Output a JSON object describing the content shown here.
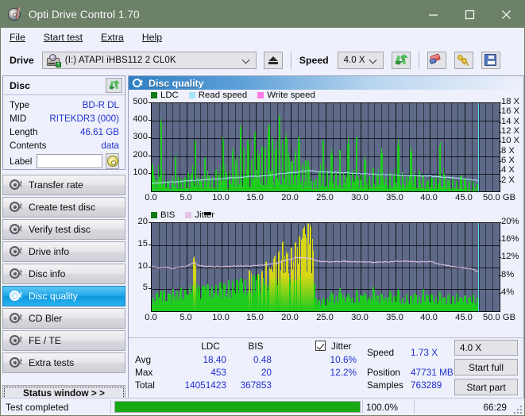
{
  "window": {
    "title": "Opti Drive Control 1.70",
    "minimize": "minimize",
    "maximize": "maximize",
    "close": "close"
  },
  "menu": [
    {
      "label": "File"
    },
    {
      "label": "Start test"
    },
    {
      "label": "Extra"
    },
    {
      "label": "Help"
    }
  ],
  "toolbar": {
    "drive_label": "Drive",
    "drive_value": "(I:)  ATAPI iHBS112  2 CL0K",
    "eject_title": "Eject",
    "speed_label": "Speed",
    "speed_value": "4.0 X",
    "refresh_title": "Refresh",
    "erase_title": "Erase",
    "keys_title": "Keys",
    "save_title": "Save"
  },
  "disc_panel": {
    "title": "Disc",
    "refresh_title": "Refresh disc info",
    "rows": [
      {
        "key": "Type",
        "value": "BD-R DL"
      },
      {
        "key": "MID",
        "value": "RITEKDR3 (000)"
      },
      {
        "key": "Length",
        "value": "46.61 GB"
      },
      {
        "key": "Contents",
        "value": "data"
      }
    ],
    "label_key": "Label",
    "label_value": "",
    "label_placeholder": ""
  },
  "sidebar": {
    "items": [
      {
        "label": "Transfer rate",
        "active": false
      },
      {
        "label": "Create test disc",
        "active": false
      },
      {
        "label": "Verify test disc",
        "active": false
      },
      {
        "label": "Drive info",
        "active": false
      },
      {
        "label": "Disc info",
        "active": false
      },
      {
        "label": "Disc quality",
        "active": true
      },
      {
        "label": "CD Bler",
        "active": false
      },
      {
        "label": "FE / TE",
        "active": false
      },
      {
        "label": "Extra tests",
        "active": false
      }
    ],
    "status_window_button": "Status window > >"
  },
  "content": {
    "header_title": "Disc quality"
  },
  "stats": {
    "col_ldc": "LDC",
    "col_bis": "BIS",
    "jitter_label": "Jitter",
    "jitter_checked": true,
    "rows": [
      {
        "name": "Avg",
        "ldc": "18.40",
        "bis": "0.48",
        "jitter": "10.6%"
      },
      {
        "name": "Max",
        "ldc": "453",
        "bis": "20",
        "jitter": "12.2%"
      },
      {
        "name": "Total",
        "ldc": "14051423",
        "bis": "367853",
        "jitter": ""
      }
    ],
    "speed_key": "Speed",
    "speed_value": "1.73 X",
    "position_key": "Position",
    "position_value": "47731 MB",
    "samples_key": "Samples",
    "samples_value": "763289",
    "speed_select_value": "4.0 X",
    "start_full": "Start full",
    "start_part": "Start part"
  },
  "statusbar": {
    "message": "Test completed",
    "progress_percent": "100.0%",
    "progress_value": 100,
    "elapsed": "66:29"
  },
  "colors": {
    "title_bar": "#6d8068",
    "accent": "#2031d0",
    "plot_bg": "#5e6a88",
    "ldc_green": "#1ecb1e",
    "bis_green": "#1ecb1e",
    "jitter_pink": "#e6c4e6",
    "read_speed": "#a8e4f7",
    "write_speed": "#ff7ae0",
    "cursor": "#63d8f5",
    "progress": "#14a814",
    "active_nav": "#22a6e8"
  },
  "chart_data": [
    {
      "type": "bar",
      "id": "ldc-chart",
      "title": "",
      "legend": [
        {
          "label": "LDC",
          "color": "#0f7a14"
        },
        {
          "label": "Read speed",
          "color": "#a8e4f7"
        },
        {
          "label": "Write speed",
          "color": "#ff7ae0"
        }
      ],
      "legend_position": "top-left",
      "xlabel": "GB",
      "ylabel": "",
      "y2label": "X",
      "xlim": [
        0.0,
        50.0
      ],
      "ylim": [
        0,
        500
      ],
      "y2lim": [
        0,
        18
      ],
      "xticks": [
        0.0,
        5.0,
        10.0,
        15.0,
        20.0,
        25.0,
        30.0,
        35.0,
        40.0,
        45.0,
        50.0
      ],
      "xticklabels": [
        "0.0",
        "5.0",
        "10.0",
        "15.0",
        "20.0",
        "25.0",
        "30.0",
        "35.0",
        "40.0",
        "45.0",
        "50.0 GB"
      ],
      "yticks": [
        100,
        200,
        300,
        400,
        500
      ],
      "yticklabels": [
        "100",
        "200",
        "300",
        "400",
        "500"
      ],
      "y2ticks": [
        2,
        4,
        6,
        8,
        10,
        12,
        14,
        16,
        18
      ],
      "y2ticklabels": [
        "2 X",
        "4 X",
        "6 X",
        "8 X",
        "10 X",
        "12 X",
        "14 X",
        "16 X",
        "18 X"
      ],
      "grid": true,
      "data_end_gb": 46.9,
      "cursor_gb": 46.9,
      "series": [
        {
          "name": "LDC",
          "color": "#1ecb1e",
          "axis": "left",
          "note": "error counts per sample, green bars; baseline rises from ~30 to ~250 near 23GB then resets",
          "x": [
            0.1,
            0.4,
            0.8,
            1.3,
            1.8,
            2.3,
            2.9,
            3.4,
            3.8,
            4.2,
            4.7,
            5.2,
            5.7,
            6.2,
            6.8,
            7.1,
            7.6,
            8.1,
            8.6,
            9.2,
            9.7,
            10.2,
            10.6,
            11.1,
            11.6,
            12.1,
            12.7,
            13.2,
            13.8,
            14.3,
            14.8,
            15.3,
            15.8,
            16.3,
            16.8,
            17.3,
            17.8,
            18.3,
            18.8,
            19.3,
            19.7,
            20.1,
            20.6,
            21.1,
            21.6,
            22.1,
            22.5,
            22.9,
            23.2,
            23.6,
            24.1,
            24.6,
            25.2,
            25.8,
            26.4,
            27.0,
            27.6,
            28.2,
            28.8,
            29.4,
            30.0,
            30.6,
            31.2,
            31.8,
            32.4,
            33.0,
            33.6,
            34.2,
            34.8,
            35.4,
            36.0,
            36.6,
            37.2,
            37.8,
            38.4,
            39.0,
            39.6,
            40.2,
            40.8,
            41.4,
            42.0,
            42.6,
            43.2,
            43.8,
            44.4,
            45.0,
            45.6,
            46.2,
            46.8
          ],
          "y": [
            155,
            70,
            60,
            445,
            55,
            60,
            70,
            210,
            80,
            65,
            75,
            110,
            95,
            310,
            70,
            60,
            205,
            90,
            75,
            130,
            95,
            330,
            110,
            90,
            255,
            160,
            390,
            230,
            300,
            170,
            355,
            200,
            260,
            240,
            390,
            300,
            230,
            455,
            260,
            330,
            200,
            160,
            230,
            320,
            150,
            180,
            170,
            60,
            55,
            70,
            120,
            310,
            100,
            240,
            90,
            250,
            80,
            310,
            95,
            330,
            60,
            200,
            75,
            140,
            90,
            250,
            70,
            110,
            85,
            300,
            95,
            75,
            260,
            80,
            120,
            90,
            60,
            80,
            70,
            290,
            100,
            60,
            75,
            55,
            95,
            70,
            60,
            55,
            40
          ]
        },
        {
          "name": "Read speed",
          "color": "#a8e4f7",
          "axis": "right",
          "note": "light blue line rising 1.6x to 4.2x then falling to 2.2x near end",
          "x": [
            0.0,
            2.0,
            4.0,
            6.0,
            8.0,
            10.0,
            12.0,
            14.0,
            16.0,
            18.0,
            20.0,
            22.0,
            23.0,
            24.0,
            26.0,
            28.0,
            30.0,
            32.0,
            34.0,
            36.0,
            38.0,
            40.0,
            42.0,
            44.0,
            46.0,
            46.9
          ],
          "y": [
            1.6,
            1.8,
            2.0,
            2.2,
            2.4,
            2.6,
            2.8,
            3.0,
            3.2,
            3.5,
            3.8,
            4.1,
            4.2,
            4.0,
            3.9,
            3.8,
            3.6,
            3.5,
            3.4,
            3.3,
            3.2,
            3.1,
            2.9,
            2.7,
            2.4,
            2.2
          ]
        },
        {
          "name": "Write speed",
          "color": "#ff7ae0",
          "axis": "right",
          "x": [],
          "y": []
        }
      ]
    },
    {
      "type": "bar",
      "id": "bis-chart",
      "title": "",
      "legend": [
        {
          "label": "BIS",
          "color": "#0f7a14"
        },
        {
          "label": "Jitter",
          "color": "#e6c4e6"
        }
      ],
      "legend_position": "top-left",
      "xlabel": "GB",
      "ylabel": "",
      "y2label": "%",
      "xlim": [
        0.0,
        50.0
      ],
      "ylim": [
        0,
        20
      ],
      "y2lim": [
        0,
        20
      ],
      "xticks": [
        0.0,
        5.0,
        10.0,
        15.0,
        20.0,
        25.0,
        30.0,
        35.0,
        40.0,
        45.0,
        50.0
      ],
      "xticklabels": [
        "0.0",
        "5.0",
        "10.0",
        "15.0",
        "20.0",
        "25.0",
        "30.0",
        "35.0",
        "40.0",
        "45.0",
        "50.0 GB"
      ],
      "yticks": [
        5,
        10,
        15,
        20
      ],
      "yticklabels": [
        "5",
        "10",
        "15",
        "20"
      ],
      "y2ticks": [
        4,
        8,
        12,
        16,
        20
      ],
      "y2ticklabels": [
        "4%",
        "8%",
        "12%",
        "16%",
        "20%"
      ],
      "grid": true,
      "data_end_gb": 46.9,
      "cursor_gb": 46.9,
      "series": [
        {
          "name": "BIS",
          "color": "#1ecb1e",
          "axis": "left",
          "note": "dense green bars; band rises from ~3 to ~20 at 23GB (saturating yellow overlap), then drops to ~2-4",
          "x": [
            0.2,
            0.7,
            1.2,
            1.8,
            2.4,
            3.0,
            3.6,
            4.2,
            4.8,
            5.4,
            6.0,
            6.2,
            6.8,
            7.4,
            8.0,
            8.6,
            9.2,
            9.8,
            10.4,
            11.0,
            11.6,
            12.2,
            12.8,
            13.4,
            14.0,
            14.6,
            15.2,
            15.8,
            16.4,
            17.0,
            17.6,
            18.2,
            18.8,
            19.4,
            20.0,
            20.6,
            21.2,
            21.8,
            22.4,
            22.8,
            23.1,
            23.5,
            24.0,
            24.6,
            25.2,
            25.8,
            26.4,
            27.0,
            27.6,
            28.2,
            28.8,
            29.4,
            30.0,
            30.6,
            31.2,
            31.8,
            32.4,
            33.0,
            33.6,
            34.2,
            34.8,
            35.4,
            36.0,
            36.6,
            37.2,
            37.8,
            38.4,
            39.0,
            39.6,
            40.2,
            40.8,
            41.4,
            42.0,
            42.6,
            43.2,
            43.8,
            44.4,
            45.0,
            45.6,
            46.2,
            46.8
          ],
          "y": [
            3.0,
            4.2,
            4.5,
            5.0,
            4.0,
            5.2,
            4.4,
            5.5,
            4.8,
            5.0,
            13.0,
            11.0,
            5.4,
            5.8,
            6.2,
            5.5,
            6.0,
            6.5,
            6.2,
            7.0,
            6.8,
            7.2,
            7.5,
            7.0,
            9.5,
            8.0,
            8.4,
            9.0,
            11.5,
            9.5,
            12.5,
            13.5,
            16.0,
            13.0,
            14.5,
            15.5,
            17.0,
            19.0,
            20.0,
            19.5,
            16.0,
            3.0,
            2.5,
            3.2,
            2.8,
            4.5,
            3.0,
            5.5,
            3.2,
            4.0,
            3.0,
            5.0,
            3.5,
            4.2,
            3.0,
            5.8,
            3.4,
            4.0,
            3.0,
            4.6,
            3.2,
            5.0,
            3.0,
            3.8,
            3.4,
            4.2,
            3.0,
            5.2,
            3.6,
            4.0,
            3.2,
            4.4,
            3.0,
            3.8,
            3.4,
            4.0,
            3.0,
            3.6,
            3.2,
            3.8,
            3.0
          ]
        },
        {
          "name": "Jitter",
          "color": "#e6c4e6",
          "axis": "right",
          "note": "pale pink line ~10% flat, peaks ~12.2% around 21GB, declines to ~9% at end",
          "x": [
            0.0,
            1.0,
            2.0,
            3.0,
            4.0,
            5.0,
            6.0,
            7.0,
            8.0,
            9.0,
            10.0,
            11.0,
            12.0,
            13.0,
            14.0,
            15.0,
            16.0,
            17.0,
            18.0,
            19.0,
            20.0,
            21.0,
            22.0,
            23.0,
            24.0,
            26.0,
            28.0,
            30.0,
            32.0,
            34.0,
            36.0,
            38.0,
            40.0,
            41.0,
            42.0,
            43.0,
            44.0,
            45.0,
            46.0,
            46.9
          ],
          "y": [
            10.2,
            9.8,
            10.0,
            9.7,
            10.0,
            10.2,
            11.0,
            10.3,
            10.2,
            10.1,
            10.2,
            10.1,
            10.2,
            10.3,
            10.2,
            10.4,
            10.5,
            10.7,
            10.9,
            11.4,
            11.9,
            12.2,
            12.1,
            11.9,
            11.3,
            11.2,
            11.3,
            11.2,
            11.1,
            11.2,
            11.4,
            11.2,
            11.3,
            10.8,
            10.5,
            10.2,
            10.0,
            9.8,
            9.6,
            9.0
          ]
        }
      ]
    }
  ]
}
